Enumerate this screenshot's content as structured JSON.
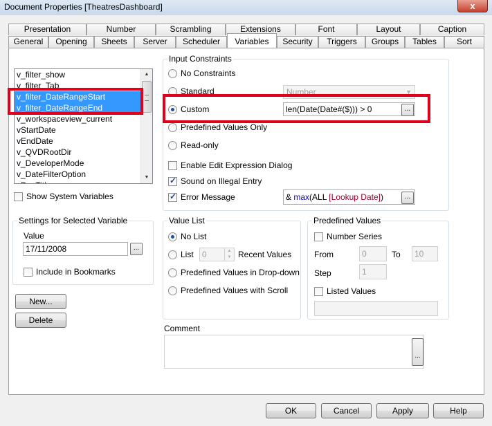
{
  "window": {
    "title": "Document Properties [TheatresDashboard]",
    "close_label": "x"
  },
  "tabs_row1": [
    "Presentation",
    "Number",
    "Scrambling",
    "Extensions",
    "Font",
    "Layout",
    "Caption"
  ],
  "tabs_row2": [
    "General",
    "Opening",
    "Sheets",
    "Server",
    "Scheduler",
    "Variables",
    "Security",
    "Triggers",
    "Groups",
    "Tables",
    "Sort"
  ],
  "active_tab": "Variables",
  "variables": {
    "items": [
      "v_filter_show",
      "v_filter_Tab",
      "v_filter_DateRangeStart",
      "v_filter_DateRangeEnd",
      "v_workspaceview_current",
      "vStartDate",
      "vEndDate",
      "v_QVDRootDir",
      "v_DeveloperMode",
      "v_DateFilterOption",
      "vDocTitle"
    ],
    "selected": [
      "v_filter_DateRangeStart",
      "v_filter_DateRangeEnd"
    ],
    "show_system_label": "Show System Variables"
  },
  "settings": {
    "title": "Settings for Selected Variable",
    "value_label": "Value",
    "value": "17/11/2008",
    "ellipsis": "...",
    "include_bookmarks_label": "Include in Bookmarks"
  },
  "buttons": {
    "new": "New...",
    "delete": "Delete",
    "ok": "OK",
    "cancel": "Cancel",
    "apply": "Apply",
    "help": "Help"
  },
  "input_constraints": {
    "title": "Input Constraints",
    "no_constraints": "No Constraints",
    "standard": "Standard",
    "standard_value": "Number",
    "custom": "Custom",
    "custom_expression": "len(Date(Date#($))) > 0",
    "predefined_only": "Predefined Values Only",
    "read_only": "Read-only",
    "enable_expr_dialog": "Enable Edit Expression Dialog",
    "sound_illegal": "Sound on Illegal Entry",
    "error_message": "Error Message",
    "error_expr_prefix": "& ",
    "error_expr_fn": "max",
    "error_expr_open": "(ALL ",
    "error_expr_field": "[Lookup Date]",
    "error_expr_close": ")"
  },
  "value_list": {
    "title": "Value List",
    "no_list": "No List",
    "list": "List",
    "recent_count": "0",
    "recent_values": "Recent Values",
    "predef_dropdown": "Predefined Values in Drop-down",
    "predef_scroll": "Predefined Values with Scroll"
  },
  "predefined_values": {
    "title": "Predefined Values",
    "number_series": "Number Series",
    "from_label": "From",
    "from_value": "0",
    "to_label": "To",
    "to_value": "10",
    "step_label": "Step",
    "step_value": "1",
    "listed_values": "Listed Values"
  },
  "comment": {
    "label": "Comment",
    "value": ""
  }
}
